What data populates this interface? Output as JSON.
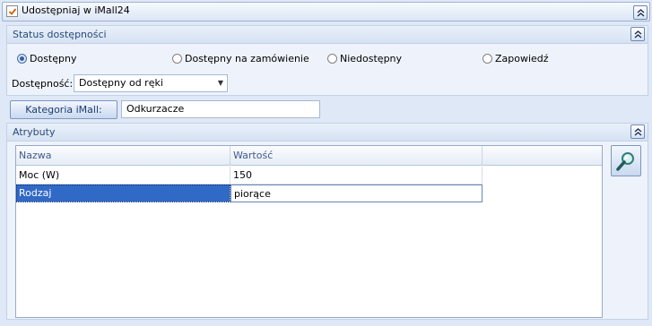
{
  "header": {
    "checkbox_label": "Udostępniaj w iMall24",
    "checked": true
  },
  "status_group": {
    "title": "Status dostępności",
    "options": [
      {
        "label": "Dostępny",
        "selected": true
      },
      {
        "label": "Dostępny na zamówienie",
        "selected": false
      },
      {
        "label": "Niedostępny",
        "selected": false
      },
      {
        "label": "Zapowiedź",
        "selected": false
      }
    ],
    "availability_label": "Dostępność:",
    "availability_value": "Dostępny od ręki"
  },
  "category": {
    "button_label": "Kategoria iMall:",
    "value": "Odkurzacze"
  },
  "attributes_group": {
    "title": "Atrybuty",
    "columns": [
      "Nazwa",
      "Wartość"
    ],
    "rows": [
      {
        "name": "Moc (W)",
        "value": "150",
        "selected": false
      },
      {
        "name": "Rodzaj",
        "value": "piorące",
        "selected": true
      }
    ]
  },
  "colors": {
    "accent": "#3169c6",
    "background": "#dfe8f6",
    "group_title": "#2b4a7a"
  }
}
